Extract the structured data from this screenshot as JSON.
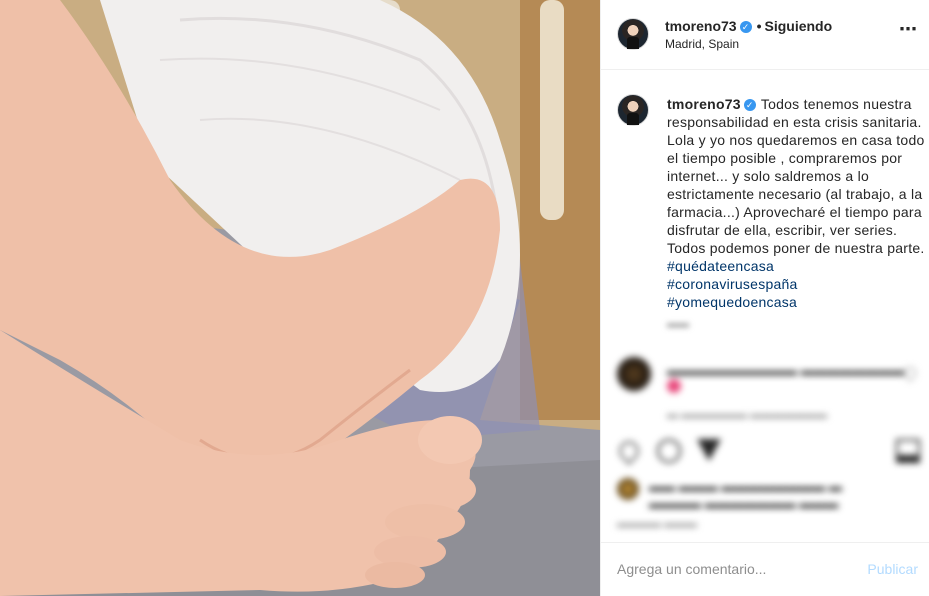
{
  "post": {
    "username": "tmoreno73",
    "verified_badge": "✓",
    "follow_status": "Siguiendo",
    "location": "Madrid, Spain",
    "more_icon": "⋯"
  },
  "caption": {
    "username": "tmoreno73",
    "text": "Todos tenemos nuestra responsabilidad en esta crisis sanitaria. Lola y yo nos quedaremos en casa todo el tiempo posible , compraremos por internet... y solo saldremos a lo estrictamente necesario (al trabajo, a la farmacia...) Aprovecharé el tiempo para disfrutar de ella, escribir, ver series. Todos podemos poner de nuestra parte.",
    "hashtags": [
      "#quédateencasa",
      "#coronavirusespaña",
      "#yomequedoencasa"
    ]
  },
  "add_comment": {
    "placeholder": "Agrega un comentario...",
    "publish_label": "Publicar"
  },
  "colors": {
    "link": "#003569",
    "verified": "#3897f0",
    "publish_disabled": "#b3dbff"
  }
}
